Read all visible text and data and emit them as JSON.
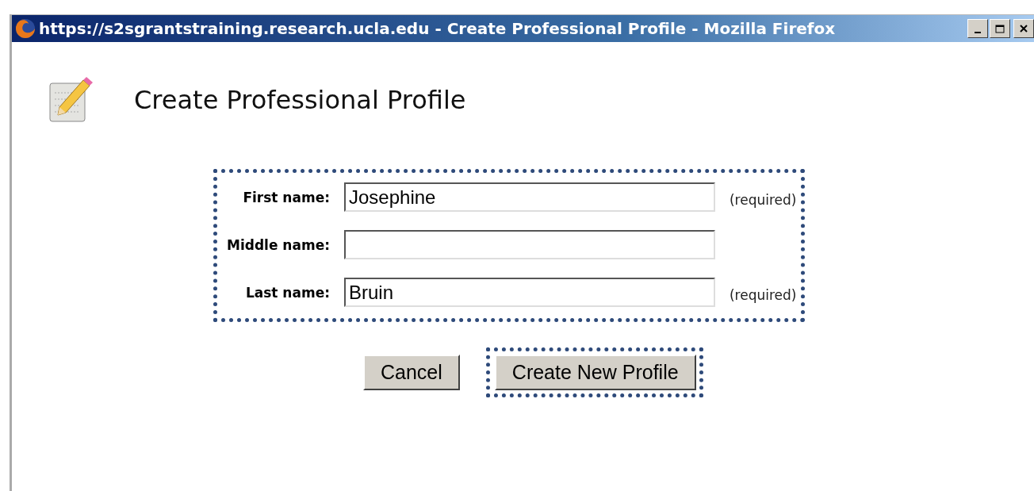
{
  "window": {
    "title": "https://s2sgrantstraining.research.ucla.edu - Create Professional Profile - Mozilla Firefox"
  },
  "page": {
    "heading": "Create Professional Profile"
  },
  "form": {
    "highlighted": true,
    "fields": [
      {
        "label": "First name:",
        "value": "Josephine",
        "note": "(required)"
      },
      {
        "label": "Middle name:"
      },
      {
        "label": "Last name:",
        "value": "Bruin",
        "note": "(required)"
      }
    ]
  },
  "buttons": [
    {
      "label": "Cancel",
      "highlighted": false
    },
    {
      "label": "Create New Profile",
      "highlighted": true
    }
  ]
}
